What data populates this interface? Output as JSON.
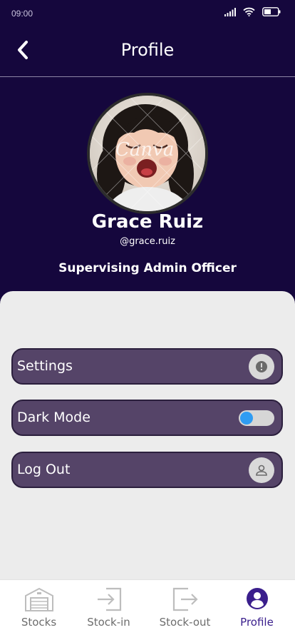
{
  "status_bar": {
    "time": "09:00"
  },
  "header": {
    "title": "Profile"
  },
  "profile": {
    "name": "Grace Ruiz",
    "handle": "@grace.ruiz",
    "role": "Supervising Admin Officer",
    "avatar_watermark": "Canva"
  },
  "menu": {
    "settings_label": "Settings",
    "dark_mode_label": "Dark Mode",
    "dark_mode_on": false,
    "logout_label": "Log Out"
  },
  "bottom_nav": {
    "tabs": [
      {
        "label": "Stocks",
        "icon": "warehouse-icon"
      },
      {
        "label": "Stock-in",
        "icon": "stock-in-icon"
      },
      {
        "label": "Stock-out",
        "icon": "stock-out-icon"
      },
      {
        "label": "Profile",
        "icon": "profile-icon",
        "active": true
      }
    ]
  },
  "colors": {
    "header_bg": "#15073d",
    "menu_item_bg": "#554468",
    "active_tab": "#3a1e8c",
    "toggle_knob": "#2f9cf3"
  }
}
